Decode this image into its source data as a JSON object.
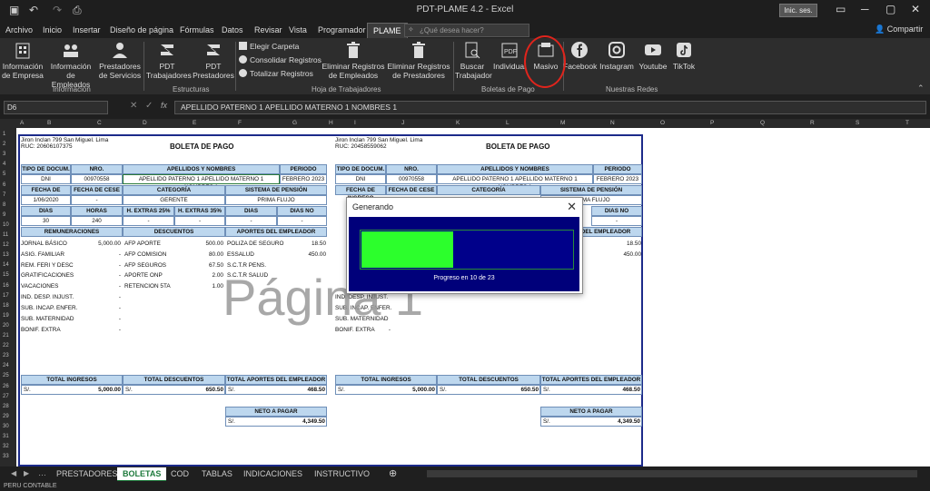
{
  "window": {
    "title": "PDT-PLAME 4.2  -  Excel",
    "signin": "Inic. ses.",
    "share": "Compartir"
  },
  "menu": {
    "tabs": [
      "Archivo",
      "Inicio",
      "Insertar",
      "Diseño de página",
      "Fórmulas",
      "Datos",
      "Revisar",
      "Vista",
      "Programador",
      "PLAME"
    ],
    "search_placeholder": "¿Qué desea hacer?"
  },
  "ribbon": {
    "info_empresa": "Información de Empresa",
    "info_empleados": "Información de Empleados",
    "prestadores": "Prestadores de Servicios",
    "group_info": "Información",
    "pdt_trab": "PDT Trabajadores",
    "pdt_prest": "PDT Prestadores",
    "group_estructuras": "Estructuras",
    "elegir": "Elegir Carpeta",
    "consolidar": "Consolidar Registros",
    "totalizar": "Totalizar Registros",
    "elim_emp": "Eliminar Registros de Empleados",
    "elim_prest": "Eliminar Registros de Prestadores",
    "group_hoja": "Hoja de Trabajadores",
    "buscar": "Buscar Trabajador",
    "individual": "Individual",
    "masivo": "Masivo",
    "group_boletas": "Boletas de Pago",
    "facebook": "Facebook",
    "instagram": "Instagram",
    "youtube": "Youtube",
    "tiktok": "TikTok",
    "group_redes": "Nuestras Redes"
  },
  "formula": {
    "cell": "D6",
    "value": "APELLIDO PATERNO 1 APELLIDO MATERNO 1 NOMBRES 1"
  },
  "columns": [
    "A",
    "B",
    "C",
    "D",
    "E",
    "F",
    "G",
    "H",
    "I",
    "J",
    "K",
    "L",
    "M",
    "N",
    "O",
    "P",
    "Q",
    "R",
    "S",
    "T"
  ],
  "rows": [
    "1",
    "2",
    "3",
    "4",
    "5",
    "6",
    "7",
    "8",
    "9",
    "10",
    "11",
    "12",
    "13",
    "14",
    "15",
    "16",
    "17",
    "18",
    "19",
    "20",
    "21",
    "22",
    "23",
    "24",
    "25",
    "26",
    "27",
    "28",
    "29",
    "30",
    "31",
    "32",
    "33"
  ],
  "boleta": {
    "address": "Jiron Inclan 799 San Miguel. Lima",
    "ruc_left": "RUC: 20606107375",
    "ruc_right": "RUC: 20458559062",
    "title": "BOLETA DE PAGO",
    "h_tipo": "TIPO DE DOCUM.",
    "h_nro": "NRO. DOCUMENTO",
    "h_apell": "APELLIDOS Y NOMBRES",
    "h_periodo": "PERIODO",
    "tipo": "DNI",
    "nro": "00970558",
    "nombre": "APELLIDO PATERNO 1 APELLIDO MATERNO 1 NOMBRES 1",
    "periodo": "FEBRERO 2023",
    "h_ingreso": "FECHA DE INGRESO",
    "h_cese": "FECHA DE CESE",
    "h_cat": "CATEGORÍA",
    "h_pension": "SISTEMA DE PENSIÓN",
    "ingreso": "1/06/2020",
    "cese": "-",
    "cat": "GERENTE",
    "pension": "PRIMA FLUJO",
    "h_dias": "DIAS LABORADOS",
    "h_horas": "HORAS LABORADAS",
    "h_ext25": "H. EXTRAS 25%",
    "h_ext35": "H. EXTRAS 35%",
    "h_subs": "DIAS SUBSIDIADOS",
    "h_nolab": "DIAS NO LAB./SUB.",
    "dias": "30",
    "horas": "240",
    "ext25": "-",
    "ext35": "-",
    "subs": "-",
    "nolab": "-",
    "h_rem": "REMUNERACIONES",
    "h_desc": "DESCUENTOS",
    "h_aport": "APORTES DEL EMPLEADOR",
    "rem": [
      [
        "JORNAL BÁSICO",
        "5,000.00"
      ],
      [
        "ASIG. FAMILIAR",
        "-"
      ],
      [
        "REM. FERI Y DESC",
        "-"
      ],
      [
        "GRATIFICACIONES",
        "-"
      ],
      [
        "VACACIONES",
        "-"
      ],
      [
        "IND. DESP. INJUST.",
        "-"
      ],
      [
        "SUB. INCAP. ENFER.",
        "-"
      ],
      [
        "SUB. MATERNIDAD",
        "-"
      ],
      [
        "BONIF. EXTRA",
        "-"
      ]
    ],
    "desc": [
      [
        "AFP APORTE",
        "500.00"
      ],
      [
        "AFP COMISION",
        "80.00"
      ],
      [
        "AFP SEGUROS",
        "67.50"
      ],
      [
        "APORTE ONP",
        "2.00"
      ],
      [
        "RETENCION 5TA",
        "1.00"
      ]
    ],
    "aport": [
      [
        "POLIZA DE SEGURO",
        "18.50"
      ],
      [
        "ESSALUD",
        "450.00"
      ],
      [
        "S.C.T.R PENS.",
        ""
      ],
      [
        "S.C.T.R SALUD",
        ""
      ]
    ],
    "h_ting": "TOTAL INGRESOS",
    "h_tdesc": "TOTAL DESCUENTOS",
    "h_taport": "TOTAL APORTES DEL EMPLEADOR",
    "cur": "S/.",
    "ting": "5,000.00",
    "tdesc": "650.50",
    "taport": "468.50",
    "h_neto": "NETO A PAGAR",
    "neto": "4,349.50"
  },
  "watermark": "Página 1",
  "dialog": {
    "title": "Generando",
    "progress_text": "Progreso en 10 de 23",
    "progress_fraction": 0.4348
  },
  "sheets": [
    "PRESTADORES",
    "BOLETAS",
    "COD",
    "TABLAS",
    "INDICACIONES",
    "INSTRUCTIVO"
  ],
  "status": "PERU CONTABLE"
}
